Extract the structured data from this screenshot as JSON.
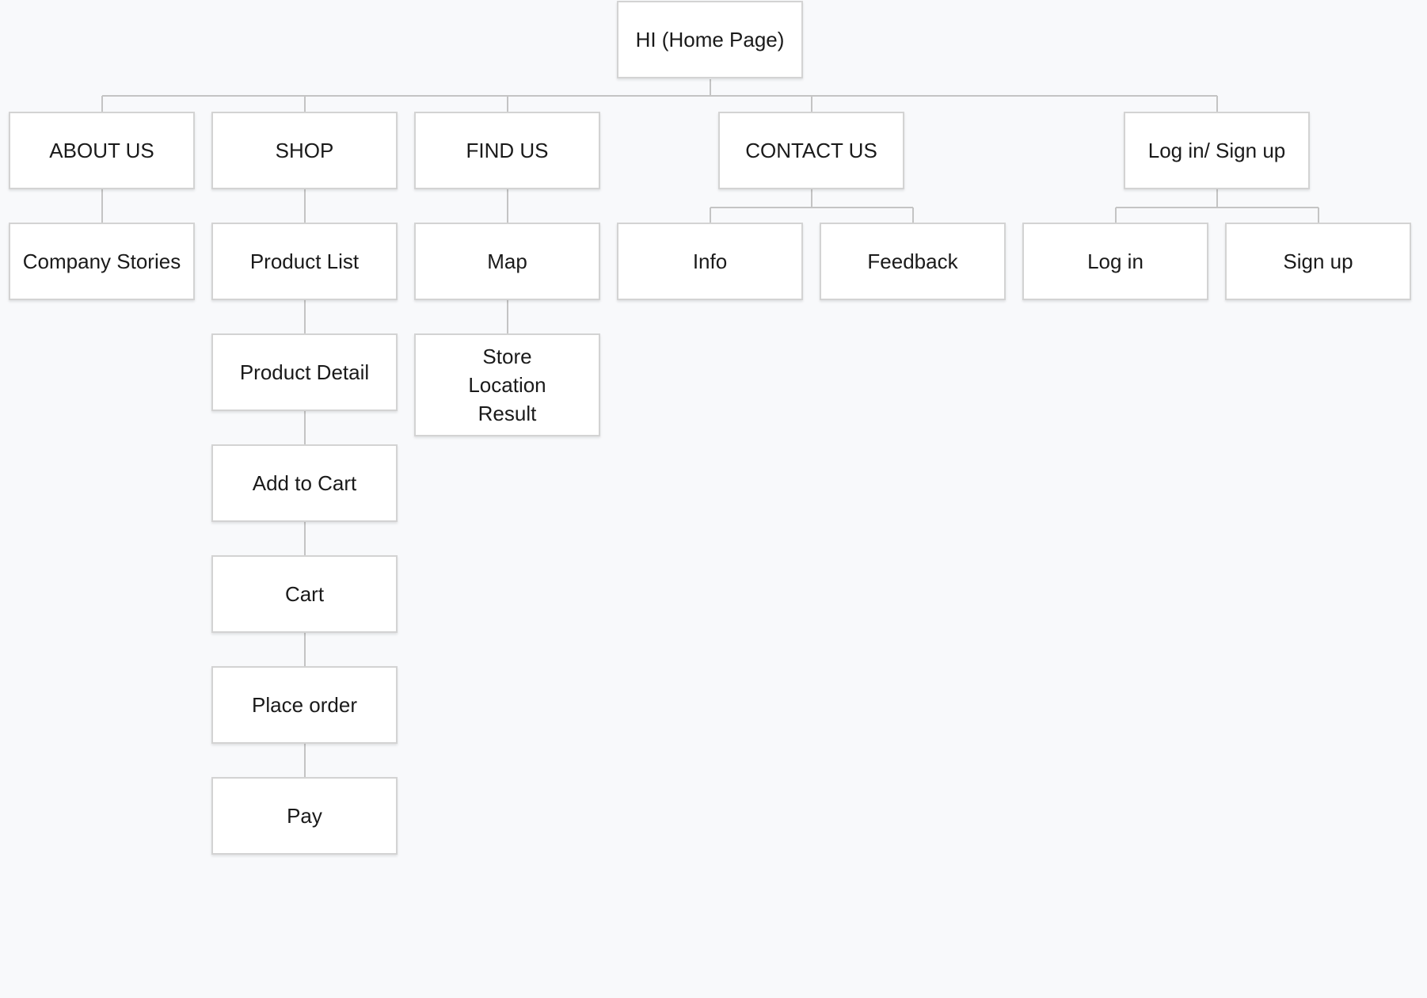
{
  "sitemap": {
    "root": {
      "label": "HI (Home Page)"
    },
    "sections": {
      "about_us": {
        "label": "ABOUT US",
        "children": [
          "Company Stories"
        ]
      },
      "shop": {
        "label": "SHOP",
        "children": [
          "Product List",
          "Product Detail",
          "Add to Cart",
          "Cart",
          "Place order",
          "Pay"
        ]
      },
      "find_us": {
        "label": "FIND US",
        "children": [
          "Map",
          "Store Location Result"
        ]
      },
      "contact_us": {
        "label": "CONTACT US",
        "children": [
          "Info",
          "Feedback"
        ]
      },
      "login_signup": {
        "label": "Log in/ Sign up",
        "children": [
          "Log in",
          "Sign up"
        ]
      }
    }
  },
  "colors": {
    "background": "#f8f9fb",
    "node_fill": "#ffffff",
    "node_border": "#d3d3d3",
    "connector": "#c4c4c4",
    "text": "#1a1a1a"
  }
}
